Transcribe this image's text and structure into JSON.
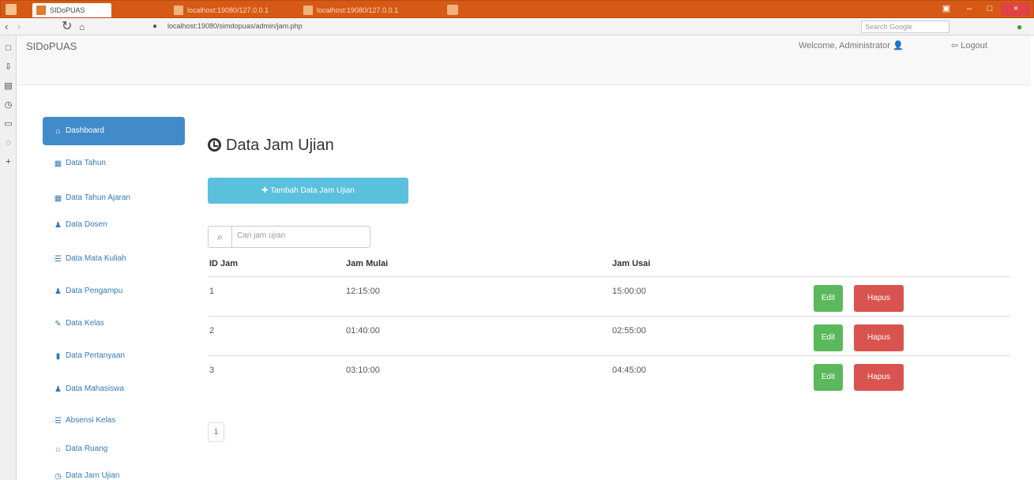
{
  "browser": {
    "tabs": [
      {
        "label": "SIDoPUAS"
      },
      {
        "label": "localhost:19080/127.0.0.1"
      },
      {
        "label": "localhost:19080/127.0.0.1"
      }
    ],
    "url": "localhost:19080/simdopuas/admin/jam.php",
    "search_placeholder": "Search Google",
    "window_buttons": {
      "restore": "▣",
      "minimize": "–",
      "maximize": "□",
      "close": "×"
    }
  },
  "app": {
    "brand": "SIDoPUAS",
    "welcome": "Welcome, Administrator",
    "logout": "Logout"
  },
  "sidebar": {
    "items": [
      {
        "label": "Dashboard",
        "icon": "home-icon"
      },
      {
        "label": "Data Tahun",
        "icon": "table-icon"
      },
      {
        "label": "Data Tahun Ajaran",
        "icon": "table-icon"
      },
      {
        "label": "Data Dosen",
        "icon": "user-icon"
      },
      {
        "label": "Data Mata Kuliah",
        "icon": "list-icon"
      },
      {
        "label": "Data Pengampu",
        "icon": "user-icon"
      },
      {
        "label": "Data Kelas",
        "icon": "pencil-icon"
      },
      {
        "label": "Data Pertanyaan",
        "icon": "book-icon"
      },
      {
        "label": "Data Mahasiswa",
        "icon": "user-icon"
      },
      {
        "label": "Absensi Kelas",
        "icon": "list-icon"
      },
      {
        "label": "Data Ruang",
        "icon": "home-icon"
      },
      {
        "label": "Data Jam Ujian",
        "icon": "clock-icon"
      }
    ]
  },
  "main": {
    "title": "Data Jam Ujian",
    "add_button": "Tambah Data Jam Ujian",
    "search_placeholder": "Cari jam ujian",
    "columns": [
      "ID Jam",
      "Jam Mulai",
      "Jam Usai"
    ],
    "rows": [
      {
        "id": "1",
        "start": "12:15:00",
        "end": "15:00:00"
      },
      {
        "id": "2",
        "start": "01:40:00",
        "end": "02:55:00"
      },
      {
        "id": "3",
        "start": "03:10:00",
        "end": "04:45:00"
      }
    ],
    "edit_label": "Edit",
    "delete_label": "Hapus",
    "pagination": [
      "1"
    ]
  },
  "colors": {
    "browser_titlebar": "#d65a15",
    "sidebar_active": "#428bca",
    "add_button": "#5bc0de",
    "edit_button": "#5cb85c",
    "delete_button": "#d9534f"
  }
}
